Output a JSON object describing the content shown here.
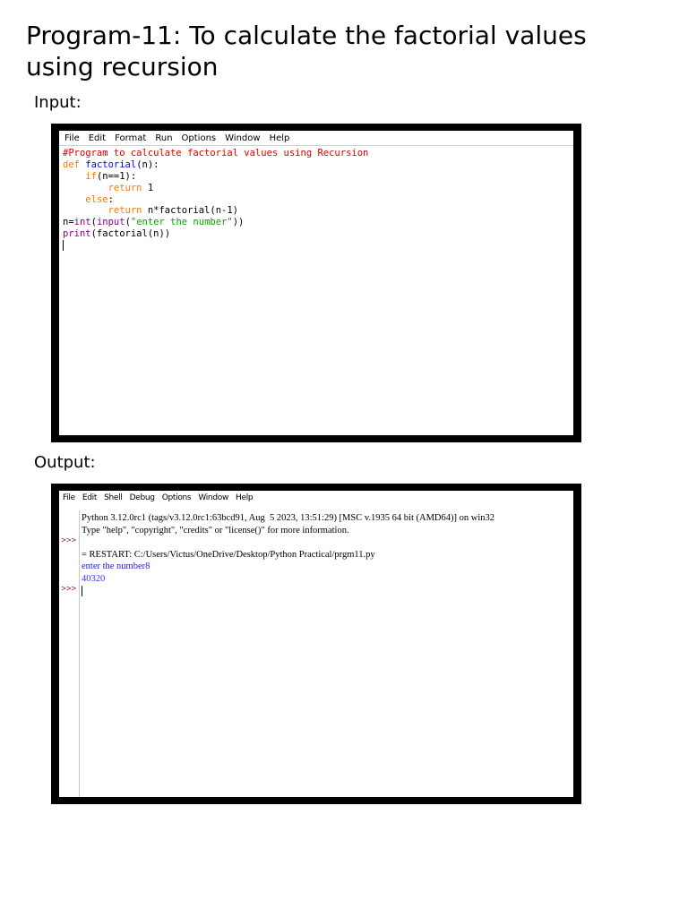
{
  "page": {
    "title": "Program-11: To calculate the factorial values using recursion",
    "input_label": "Input:",
    "output_label": "Output:"
  },
  "editor": {
    "menu": [
      "File",
      "Edit",
      "Format",
      "Run",
      "Options",
      "Window",
      "Help"
    ],
    "code": {
      "line1_comment": "#Program to calculate factorial values using Recursion",
      "line2_def": "def",
      "line2_name": "factorial",
      "line2_rest": "(n):",
      "line3_indent": "    ",
      "line3_if": "if",
      "line3_rest": "(n==1):",
      "line4_indent": "        ",
      "line4_return": "return",
      "line4_value": "1",
      "line5_indent": "    ",
      "line5_else": "else",
      "line5_colon": ":",
      "line6_indent": "        ",
      "line6_return": "return",
      "line6_rest": " n*factorial(n-1)",
      "line7_var": "n=",
      "line7_int": "int",
      "line7_paren": "(",
      "line7_input": "input",
      "line7_paren2": "(",
      "line7_string": "\"enter the number\"",
      "line7_close": "))",
      "line8_print": "print",
      "line8_rest": "(factorial(n))"
    }
  },
  "shell": {
    "menu": [
      "File",
      "Edit",
      "Shell",
      "Debug",
      "Options",
      "Window",
      "Help"
    ],
    "prompts": [
      ">>>",
      ">>>"
    ],
    "lines": {
      "banner1": "Python 3.12.0rc1 (tags/v3.12.0rc1:63bcd91, Aug  5 2023, 13:51:29) [MSC v.1935 64 bit (AMD64)] on win32",
      "banner2": "Type \"help\", \"copyright\", \"credits\" or \"license()\" for more information.",
      "restart": "= RESTART: C:/Users/Victus/OneDrive/Desktop/Python Practical/prgm11.py",
      "prompt_text": "enter the number8",
      "result": "40320"
    }
  },
  "colors": {
    "keyword": "#ff7700",
    "function_name": "#0000ff",
    "builtin": "#900090",
    "comment": "#dd0000",
    "string": "#00aa00",
    "shell_prompt": "#8b0000",
    "shell_output": "#1f1fd0"
  }
}
